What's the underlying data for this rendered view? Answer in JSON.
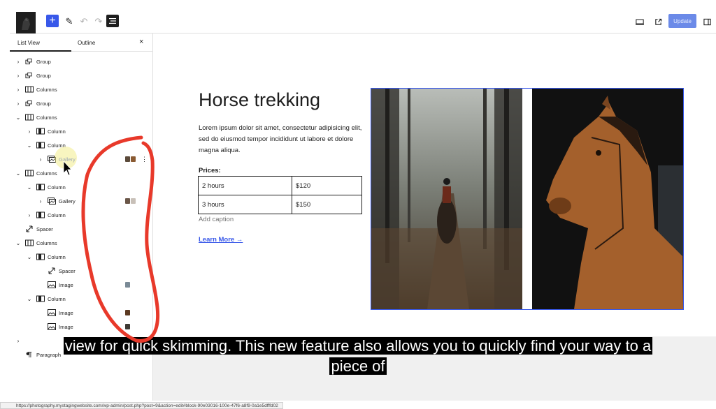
{
  "toolbar": {
    "add_label": "+",
    "update_label": "Update"
  },
  "sidebar": {
    "tabs": [
      "List View",
      "Outline"
    ],
    "close_label": "×",
    "items": [
      {
        "label": "Group",
        "depth": 0,
        "chevron": "›",
        "icon": "group"
      },
      {
        "label": "Group",
        "depth": 0,
        "chevron": "›",
        "icon": "group"
      },
      {
        "label": "Columns",
        "depth": 0,
        "chevron": "›",
        "icon": "columns"
      },
      {
        "label": "Group",
        "depth": 0,
        "chevron": "›",
        "icon": "group"
      },
      {
        "label": "Columns",
        "depth": 0,
        "chevron": "⌄",
        "icon": "columns"
      },
      {
        "label": "Column",
        "depth": 1,
        "chevron": "›",
        "icon": "column"
      },
      {
        "label": "Column",
        "depth": 1,
        "chevron": "⌄",
        "icon": "column"
      },
      {
        "label": "Gallery",
        "depth": 2,
        "chevron": "›",
        "icon": "gallery",
        "selected": true,
        "thumbs": [
          "#5b4a3a",
          "#8a5a32"
        ],
        "more": "⋮"
      },
      {
        "label": "Columns",
        "depth": 0,
        "chevron": "⌄",
        "icon": "columns"
      },
      {
        "label": "Column",
        "depth": 1,
        "chevron": "⌄",
        "icon": "column"
      },
      {
        "label": "Gallery",
        "depth": 2,
        "chevron": "›",
        "icon": "gallery",
        "thumbs": [
          "#6a5648",
          "#c8c0b8"
        ]
      },
      {
        "label": "Column",
        "depth": 1,
        "chevron": "›",
        "icon": "column"
      },
      {
        "label": "Spacer",
        "depth": 0,
        "chevron": "",
        "icon": "spacer"
      },
      {
        "label": "Columns",
        "depth": 0,
        "chevron": "⌄",
        "icon": "columns"
      },
      {
        "label": "Column",
        "depth": 1,
        "chevron": "⌄",
        "icon": "column"
      },
      {
        "label": "Spacer",
        "depth": 2,
        "chevron": "",
        "icon": "spacer"
      },
      {
        "label": "Image",
        "depth": 2,
        "chevron": "",
        "icon": "image",
        "thumbs": [
          "#7a8a96"
        ]
      },
      {
        "label": "Column",
        "depth": 1,
        "chevron": "⌄",
        "icon": "column"
      },
      {
        "label": "Image",
        "depth": 2,
        "chevron": "",
        "icon": "image",
        "thumbs": [
          "#5c3a22"
        ]
      },
      {
        "label": "Image",
        "depth": 2,
        "chevron": "",
        "icon": "image",
        "thumbs": [
          "#3e3a34"
        ]
      },
      {
        "label": "",
        "depth": 0,
        "chevron": "›",
        "icon": "none"
      },
      {
        "label": "Paragraph",
        "depth": 0,
        "chevron": "",
        "icon": "paragraph"
      }
    ]
  },
  "content": {
    "title": "Horse trekking",
    "intro": "Lorem ipsum dolor sit amet, consectetur adipisicing elit, sed do eiusmod tempor incididunt ut labore et dolore magna aliqua.",
    "prices_heading": "Prices:",
    "prices": [
      {
        "duration": "2 hours",
        "price": "$120"
      },
      {
        "duration": "3 hours",
        "price": "$150"
      }
    ],
    "caption": "Add caption",
    "learn_more": "Learn More →"
  },
  "subtitles": {
    "line1": "view for quick skimming. This new feature also allows you to quickly find your way to a",
    "line2": "piece of"
  },
  "status_bar": {
    "url": "https://photography.mystagingwebsite.com/wp-admin/post.php?post=9&action=edit#block-90e03016-100e-47f6-a8f9-0a1e5dfffd02"
  },
  "colors": {
    "accent": "#3858e9",
    "annotation": "#e8392a"
  }
}
